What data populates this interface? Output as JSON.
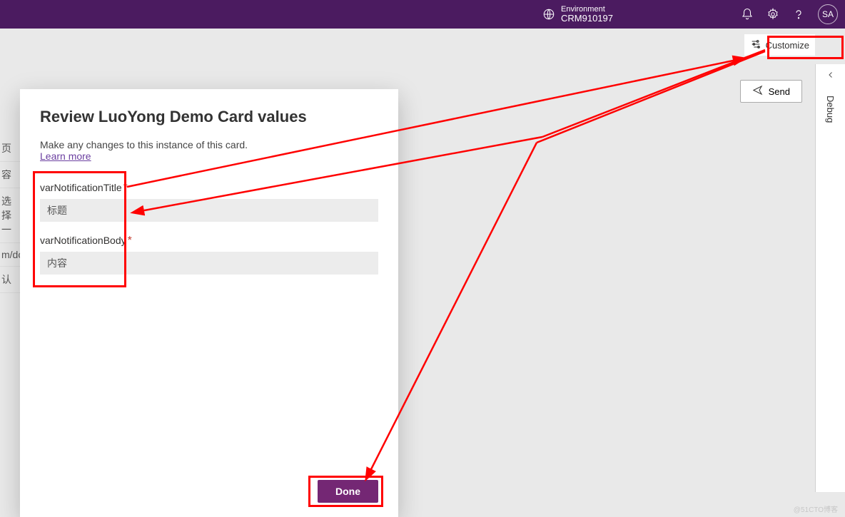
{
  "header": {
    "env_label": "Environment",
    "env_name": "CRM910197",
    "avatar": "SA"
  },
  "toolbar": {
    "customize_label": "Customize",
    "send_label": "Send"
  },
  "rail": {
    "debug_label": "Debug"
  },
  "modal": {
    "title": "Review LuoYong Demo Card values",
    "subtitle": "Make any changes to this instance of this card.",
    "learn_more": "Learn more",
    "fields": [
      {
        "label": "varNotificationTitle",
        "value": "标题"
      },
      {
        "label": "varNotificationBody",
        "value": "内容"
      }
    ],
    "done_label": "Done"
  },
  "bg_fragments": [
    "页",
    "容",
    "选择一",
    "m/do",
    "认"
  ],
  "watermark": "@51CTO博客"
}
